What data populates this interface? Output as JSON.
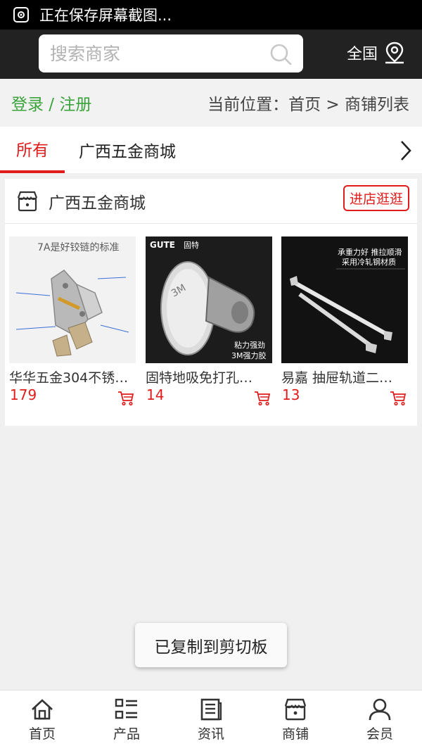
{
  "status_bar": {
    "text": "正在保存屏幕截图..."
  },
  "search": {
    "placeholder": "搜索商家"
  },
  "region": {
    "label": "全国"
  },
  "crumb_bar": {
    "login": "登录 / 注册",
    "breadcrumb": "当前位置：首页 > 商铺列表"
  },
  "tabs": [
    {
      "label": "所有",
      "active": true
    },
    {
      "label": "广西五金商城",
      "active": false
    }
  ],
  "shop": {
    "name": "广西五金商城",
    "visit_label": "进店逛逛",
    "products": [
      {
        "name": "华华五金304不锈…",
        "price": "179",
        "image_text": "7A是好铰链的标准"
      },
      {
        "name": "固特地吸免打孔…",
        "price": "14",
        "image_brand": "GUTE",
        "image_brand_cn": "固特",
        "image_caption_1": "粘力强劲",
        "image_caption_2": "3M强力胶",
        "image_print": "3M"
      },
      {
        "name": "易嘉 抽屉轨道二…",
        "price": "13",
        "image_line_1": "承重力好  推拉顺滑",
        "image_line_2": "采用冷轧钢材质"
      }
    ]
  },
  "toast": {
    "text": "已复制到剪切板"
  },
  "bottom_nav": [
    {
      "label": "首页",
      "icon": "home-icon"
    },
    {
      "label": "产品",
      "icon": "grid-list-icon"
    },
    {
      "label": "资讯",
      "icon": "news-icon"
    },
    {
      "label": "商铺",
      "icon": "store-icon"
    },
    {
      "label": "会员",
      "icon": "user-icon"
    }
  ],
  "colors": {
    "accent_red": "#e01c1c",
    "login_green": "#3aa33a",
    "header_bg": "#222222",
    "status_bg": "#000000"
  }
}
